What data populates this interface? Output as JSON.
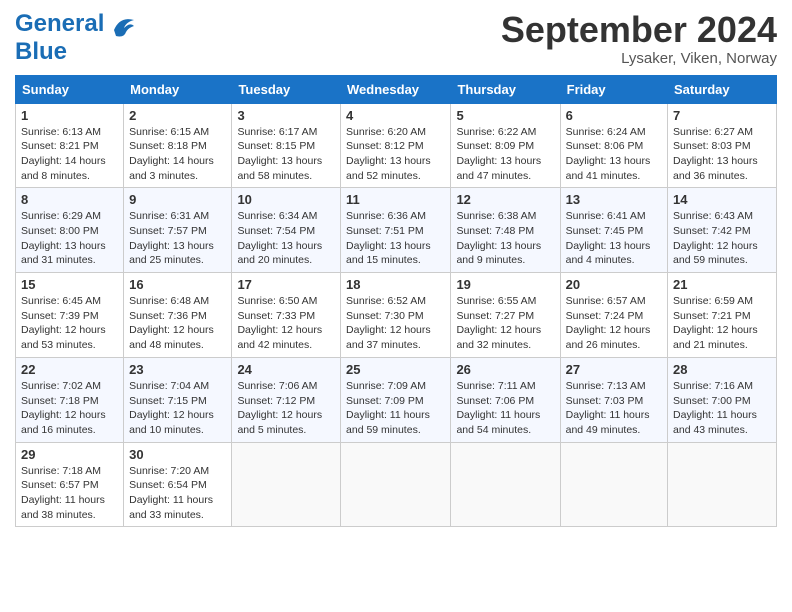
{
  "header": {
    "logo_general": "General",
    "logo_blue": "Blue",
    "month_title": "September 2024",
    "location": "Lysaker, Viken, Norway"
  },
  "days_of_week": [
    "Sunday",
    "Monday",
    "Tuesday",
    "Wednesday",
    "Thursday",
    "Friday",
    "Saturday"
  ],
  "weeks": [
    [
      {
        "day": "1",
        "info": "Sunrise: 6:13 AM\nSunset: 8:21 PM\nDaylight: 14 hours\nand 8 minutes."
      },
      {
        "day": "2",
        "info": "Sunrise: 6:15 AM\nSunset: 8:18 PM\nDaylight: 14 hours\nand 3 minutes."
      },
      {
        "day": "3",
        "info": "Sunrise: 6:17 AM\nSunset: 8:15 PM\nDaylight: 13 hours\nand 58 minutes."
      },
      {
        "day": "4",
        "info": "Sunrise: 6:20 AM\nSunset: 8:12 PM\nDaylight: 13 hours\nand 52 minutes."
      },
      {
        "day": "5",
        "info": "Sunrise: 6:22 AM\nSunset: 8:09 PM\nDaylight: 13 hours\nand 47 minutes."
      },
      {
        "day": "6",
        "info": "Sunrise: 6:24 AM\nSunset: 8:06 PM\nDaylight: 13 hours\nand 41 minutes."
      },
      {
        "day": "7",
        "info": "Sunrise: 6:27 AM\nSunset: 8:03 PM\nDaylight: 13 hours\nand 36 minutes."
      }
    ],
    [
      {
        "day": "8",
        "info": "Sunrise: 6:29 AM\nSunset: 8:00 PM\nDaylight: 13 hours\nand 31 minutes."
      },
      {
        "day": "9",
        "info": "Sunrise: 6:31 AM\nSunset: 7:57 PM\nDaylight: 13 hours\nand 25 minutes."
      },
      {
        "day": "10",
        "info": "Sunrise: 6:34 AM\nSunset: 7:54 PM\nDaylight: 13 hours\nand 20 minutes."
      },
      {
        "day": "11",
        "info": "Sunrise: 6:36 AM\nSunset: 7:51 PM\nDaylight: 13 hours\nand 15 minutes."
      },
      {
        "day": "12",
        "info": "Sunrise: 6:38 AM\nSunset: 7:48 PM\nDaylight: 13 hours\nand 9 minutes."
      },
      {
        "day": "13",
        "info": "Sunrise: 6:41 AM\nSunset: 7:45 PM\nDaylight: 13 hours\nand 4 minutes."
      },
      {
        "day": "14",
        "info": "Sunrise: 6:43 AM\nSunset: 7:42 PM\nDaylight: 12 hours\nand 59 minutes."
      }
    ],
    [
      {
        "day": "15",
        "info": "Sunrise: 6:45 AM\nSunset: 7:39 PM\nDaylight: 12 hours\nand 53 minutes."
      },
      {
        "day": "16",
        "info": "Sunrise: 6:48 AM\nSunset: 7:36 PM\nDaylight: 12 hours\nand 48 minutes."
      },
      {
        "day": "17",
        "info": "Sunrise: 6:50 AM\nSunset: 7:33 PM\nDaylight: 12 hours\nand 42 minutes."
      },
      {
        "day": "18",
        "info": "Sunrise: 6:52 AM\nSunset: 7:30 PM\nDaylight: 12 hours\nand 37 minutes."
      },
      {
        "day": "19",
        "info": "Sunrise: 6:55 AM\nSunset: 7:27 PM\nDaylight: 12 hours\nand 32 minutes."
      },
      {
        "day": "20",
        "info": "Sunrise: 6:57 AM\nSunset: 7:24 PM\nDaylight: 12 hours\nand 26 minutes."
      },
      {
        "day": "21",
        "info": "Sunrise: 6:59 AM\nSunset: 7:21 PM\nDaylight: 12 hours\nand 21 minutes."
      }
    ],
    [
      {
        "day": "22",
        "info": "Sunrise: 7:02 AM\nSunset: 7:18 PM\nDaylight: 12 hours\nand 16 minutes."
      },
      {
        "day": "23",
        "info": "Sunrise: 7:04 AM\nSunset: 7:15 PM\nDaylight: 12 hours\nand 10 minutes."
      },
      {
        "day": "24",
        "info": "Sunrise: 7:06 AM\nSunset: 7:12 PM\nDaylight: 12 hours\nand 5 minutes."
      },
      {
        "day": "25",
        "info": "Sunrise: 7:09 AM\nSunset: 7:09 PM\nDaylight: 11 hours\nand 59 minutes."
      },
      {
        "day": "26",
        "info": "Sunrise: 7:11 AM\nSunset: 7:06 PM\nDaylight: 11 hours\nand 54 minutes."
      },
      {
        "day": "27",
        "info": "Sunrise: 7:13 AM\nSunset: 7:03 PM\nDaylight: 11 hours\nand 49 minutes."
      },
      {
        "day": "28",
        "info": "Sunrise: 7:16 AM\nSunset: 7:00 PM\nDaylight: 11 hours\nand 43 minutes."
      }
    ],
    [
      {
        "day": "29",
        "info": "Sunrise: 7:18 AM\nSunset: 6:57 PM\nDaylight: 11 hours\nand 38 minutes."
      },
      {
        "day": "30",
        "info": "Sunrise: 7:20 AM\nSunset: 6:54 PM\nDaylight: 11 hours\nand 33 minutes."
      },
      {
        "day": "",
        "info": ""
      },
      {
        "day": "",
        "info": ""
      },
      {
        "day": "",
        "info": ""
      },
      {
        "day": "",
        "info": ""
      },
      {
        "day": "",
        "info": ""
      }
    ]
  ]
}
